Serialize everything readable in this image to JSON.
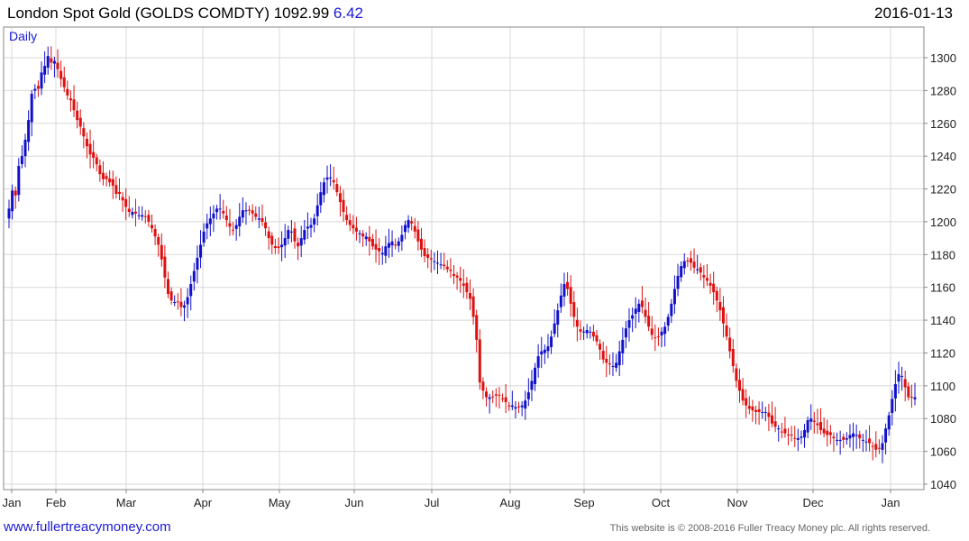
{
  "header": {
    "title": "London Spot Gold (GOLDS COMDTY) 1092.99",
    "change": "6.42",
    "date": "2016-01-13"
  },
  "footer": {
    "website": "www.fullertreacymoney.com",
    "copyright": "This website is © 2008-2016 Fuller Treacy Money plc. All rights reserved."
  },
  "colors": {
    "up": "#1111cc",
    "down": "#dd1111",
    "grid": "#d8d8d8",
    "frame": "#888888"
  },
  "chart_data": {
    "type": "candlestick",
    "period_label": "Daily",
    "y_ticks": [
      1040,
      1060,
      1080,
      1100,
      1120,
      1140,
      1160,
      1180,
      1200,
      1220,
      1240,
      1260,
      1280,
      1300
    ],
    "ylim": [
      1035,
      1310
    ],
    "x_labels": [
      "Jan",
      "Feb",
      "Mar",
      "Apr",
      "May",
      "Jun",
      "Jul",
      "Aug",
      "Sep",
      "Oct",
      "Nov",
      "Dec",
      "Jan"
    ],
    "closes": [
      1208,
      1219,
      1216,
      1234,
      1240,
      1250,
      1262,
      1278,
      1281,
      1281,
      1291,
      1295,
      1301,
      1297,
      1298,
      1293,
      1287,
      1282,
      1277,
      1274,
      1268,
      1262,
      1258,
      1252,
      1246,
      1241,
      1239,
      1235,
      1229,
      1226,
      1226,
      1224,
      1222,
      1217,
      1217,
      1213,
      1209,
      1206,
      1206,
      1205,
      1204,
      1204,
      1203,
      1200,
      1196,
      1191,
      1186,
      1177,
      1166,
      1156,
      1152,
      1151,
      1151,
      1148,
      1149,
      1154,
      1162,
      1170,
      1178,
      1186,
      1194,
      1199,
      1202,
      1205,
      1208,
      1208,
      1205,
      1201,
      1197,
      1195,
      1198,
      1203,
      1207,
      1207,
      1207,
      1205,
      1203,
      1202,
      1200,
      1196,
      1190,
      1186,
      1184,
      1184,
      1186,
      1190,
      1195,
      1194,
      1188,
      1185,
      1190,
      1195,
      1197,
      1198,
      1202,
      1210,
      1218,
      1224,
      1227,
      1227,
      1224,
      1218,
      1212,
      1206,
      1201,
      1198,
      1196,
      1194,
      1193,
      1191,
      1191,
      1188,
      1185,
      1183,
      1182,
      1181,
      1185,
      1187,
      1188,
      1186,
      1188,
      1192,
      1198,
      1201,
      1199,
      1194,
      1188,
      1183,
      1179,
      1178,
      1177,
      1176,
      1175,
      1174,
      1173,
      1171,
      1170,
      1167,
      1166,
      1164,
      1161,
      1157,
      1153,
      1142,
      1128,
      1102,
      1097,
      1093,
      1093,
      1093,
      1094,
      1094,
      1092,
      1090,
      1088,
      1088,
      1087,
      1087,
      1088,
      1091,
      1096,
      1103,
      1111,
      1118,
      1121,
      1122,
      1124,
      1130,
      1138,
      1146,
      1155,
      1162,
      1159,
      1150,
      1142,
      1136,
      1133,
      1133,
      1134,
      1133,
      1130,
      1127,
      1122,
      1116,
      1114,
      1113,
      1112,
      1114,
      1121,
      1128,
      1135,
      1140,
      1143,
      1147,
      1150,
      1148,
      1142,
      1136,
      1131,
      1129,
      1130,
      1133,
      1136,
      1142,
      1150,
      1159,
      1167,
      1173,
      1176,
      1176,
      1175,
      1172,
      1171,
      1169,
      1166,
      1164,
      1161,
      1157,
      1152,
      1146,
      1138,
      1130,
      1121,
      1112,
      1103,
      1097,
      1091,
      1088,
      1086,
      1085,
      1084,
      1084,
      1084,
      1084,
      1081,
      1077,
      1075,
      1074,
      1072,
      1071,
      1070,
      1070,
      1068,
      1068,
      1069,
      1073,
      1079,
      1080,
      1078,
      1076,
      1073,
      1071,
      1070,
      1070,
      1068,
      1067,
      1067,
      1067,
      1068,
      1070,
      1071,
      1070,
      1068,
      1067,
      1066,
      1065,
      1063,
      1061,
      1062,
      1065,
      1074,
      1082,
      1092,
      1101,
      1107,
      1106,
      1099,
      1093,
      1093,
      1093
    ]
  }
}
